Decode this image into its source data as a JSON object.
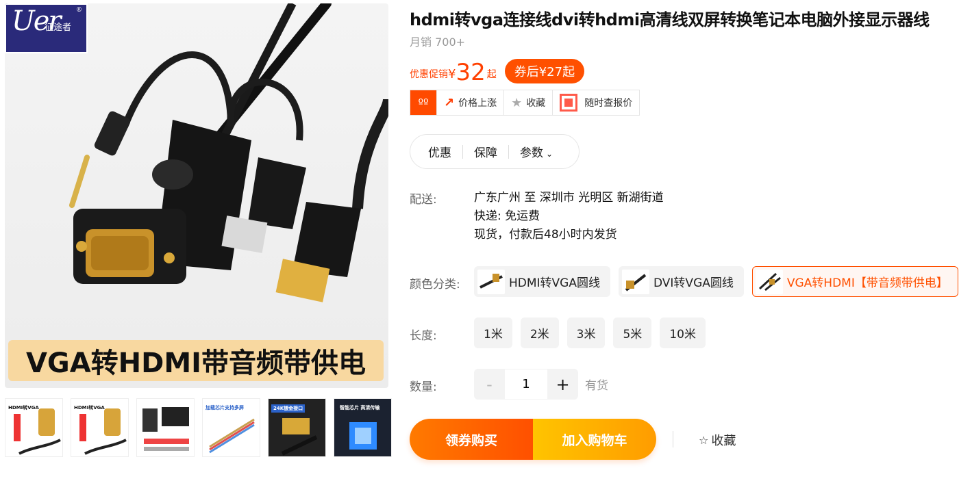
{
  "gallery": {
    "logo_script": "Uer",
    "logo_cn": "征途者",
    "logo_reg": "®",
    "banner": "VGA转HDMI带音频带供电",
    "thumbs": [
      {
        "label": "HDMI转VGA"
      },
      {
        "label": "HDMI转VGA"
      },
      {
        "label": ""
      },
      {
        "label": "加载芯片支持多屏"
      },
      {
        "label": "24K镀金接口"
      },
      {
        "label": "智能芯片 高清传输"
      }
    ]
  },
  "product": {
    "title": "hdmi转vga连接线dvi转hdmi高清线双屏转换笔记本电脑外接显示器线",
    "sales": "月销 700+"
  },
  "price": {
    "label": "优惠促销",
    "currency": "¥",
    "amount": "32",
    "suffix": "起",
    "coupon": "券后¥27起"
  },
  "actions": {
    "avatar": "ºº",
    "price_up": "价格上涨",
    "favorite": "收藏",
    "price_alert": "随时查报价"
  },
  "tabs": [
    "优惠",
    "保障",
    "参数"
  ],
  "shipping": {
    "label": "配送:",
    "route": "广东广州 至 深圳市 光明区 新湖街道",
    "express": "快递: 免运费",
    "stock_note": "现货，付款后48小时内发货"
  },
  "colors": {
    "label": "颜色分类:",
    "options": [
      {
        "name": "HDMI转VGA圆线",
        "selected": false
      },
      {
        "name": "DVI转VGA圆线",
        "selected": false
      },
      {
        "name": "VGA转HDMI【带音频带供电】",
        "selected": true
      }
    ]
  },
  "length": {
    "label": "长度:",
    "options": [
      "1米",
      "2米",
      "3米",
      "5米",
      "10米"
    ]
  },
  "quantity": {
    "label": "数量:",
    "minus": "-",
    "value": "1",
    "plus": "+",
    "stock": "有货"
  },
  "buttons": {
    "coupon_buy": "领券购买",
    "add_cart": "加入购物车",
    "favorite": "收藏"
  },
  "theme": {
    "accent": "#ff5000",
    "cart": "#ffa800"
  }
}
